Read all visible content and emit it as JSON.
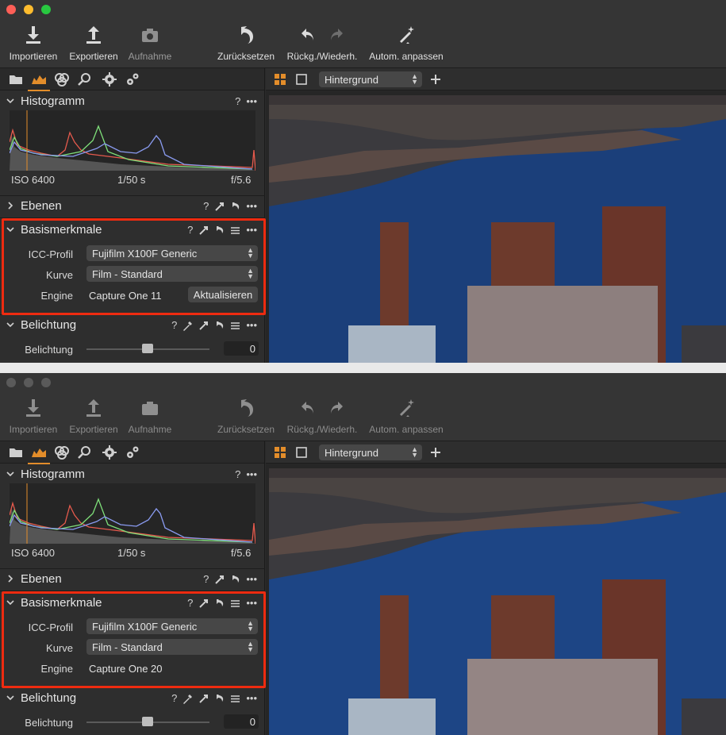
{
  "screens": [
    {
      "toolbar": {
        "import_label": "Importieren",
        "export_label": "Exportieren",
        "capture_label": "Aufnahme",
        "reset_label": "Zurücksetzen",
        "undo_redo_label": "Rückg./Wiederh.",
        "auto_adjust_label": "Autom. anpassen"
      },
      "viewer": {
        "layer_select": "Hintergrund"
      },
      "histogram": {
        "title": "Histogramm",
        "iso": "ISO 6400",
        "shutter": "1/50 s",
        "aperture": "f/5.6",
        "help": "?"
      },
      "layers": {
        "title": "Ebenen",
        "help": "?"
      },
      "base": {
        "title": "Basismerkmale",
        "help": "?",
        "icc_label": "ICC-Profil",
        "icc_value": "Fujifilm X100F Generic",
        "curve_label": "Kurve",
        "curve_value": "Film - Standard",
        "engine_label": "Engine",
        "engine_value": "Capture One 11",
        "update_button": "Aktualisieren"
      },
      "exposure": {
        "title": "Belichtung",
        "help": "?",
        "label": "Belichtung",
        "value": "0"
      }
    },
    {
      "toolbar": {
        "import_label": "Importieren",
        "export_label": "Exportieren",
        "capture_label": "Aufnahme",
        "reset_label": "Zurücksetzen",
        "undo_redo_label": "Rückg./Wiederh.",
        "auto_adjust_label": "Autom. anpassen"
      },
      "viewer": {
        "layer_select": "Hintergrund"
      },
      "histogram": {
        "title": "Histogramm",
        "iso": "ISO 6400",
        "shutter": "1/50 s",
        "aperture": "f/5.6",
        "help": "?"
      },
      "layers": {
        "title": "Ebenen",
        "help": "?"
      },
      "base": {
        "title": "Basismerkmale",
        "help": "?",
        "icc_label": "ICC-Profil",
        "icc_value": "Fujifilm X100F Generic",
        "curve_label": "Kurve",
        "curve_value": "Film - Standard",
        "engine_label": "Engine",
        "engine_value": "Capture One 20"
      },
      "exposure": {
        "title": "Belichtung",
        "help": "?",
        "label": "Belichtung",
        "value": "0"
      }
    }
  ],
  "colors": {
    "accent": "#e38d2a",
    "highlight_border": "#ee2b10",
    "panel": "#2e2e2e",
    "water": "#1b3f7a"
  }
}
